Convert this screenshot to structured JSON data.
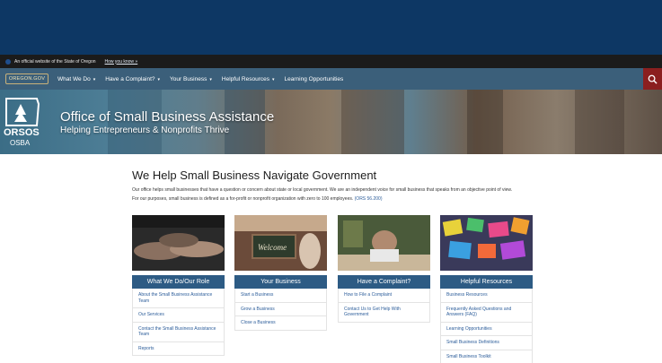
{
  "top_bar": {
    "official_text": "An official website of the State of Oregon",
    "how_you_know": "How you know »"
  },
  "nav": {
    "logo_text": "OREGON.GOV",
    "items": [
      {
        "label": "What We Do",
        "dropdown": true
      },
      {
        "label": "Have a Complaint?",
        "dropdown": true
      },
      {
        "label": "Your Business",
        "dropdown": true
      },
      {
        "label": "Helpful Resources",
        "dropdown": true
      },
      {
        "label": "Learning Opportunities",
        "dropdown": false
      }
    ],
    "search_icon": "search-icon"
  },
  "hero": {
    "logo_text": "ORSOS",
    "logo_subtext": "OSBA",
    "title": "Office of Small Business Assistance",
    "subtitle": "Helping Entrepreneurs & Nonprofits Thrive"
  },
  "main": {
    "heading": "We Help Small Business Navigate Government",
    "intro": "Our office helps small businesses that have a question or concern about state or local government. We are an independent voice for small business that speaks from an objective point of view.",
    "purpose": "For our purposes, small business is defined as a for-profit or nonprofit organization with zero to 100 employees.",
    "purpose_link": "(ORS 56.200)"
  },
  "cards": [
    {
      "title": "What We Do/Our Role",
      "links": [
        "About the Small Business Assistance Team",
        "Our Services",
        "Contact the Small Business Assistance Team",
        "Reports"
      ]
    },
    {
      "title": "Your Business",
      "links": [
        "Start a Business",
        "Grow a Business",
        "Close a Business"
      ]
    },
    {
      "title": "Have a Complaint?",
      "links": [
        "How to File a Complaint",
        "Contact Us to Get Help With Government"
      ]
    },
    {
      "title": "Helpful Resources",
      "links": [
        "Business Resources",
        "Frequently Asked Questions and Answers (FAQ)",
        "Learning Opportunities",
        "Small Business Definitions",
        "Small Business Toolkit"
      ]
    }
  ]
}
